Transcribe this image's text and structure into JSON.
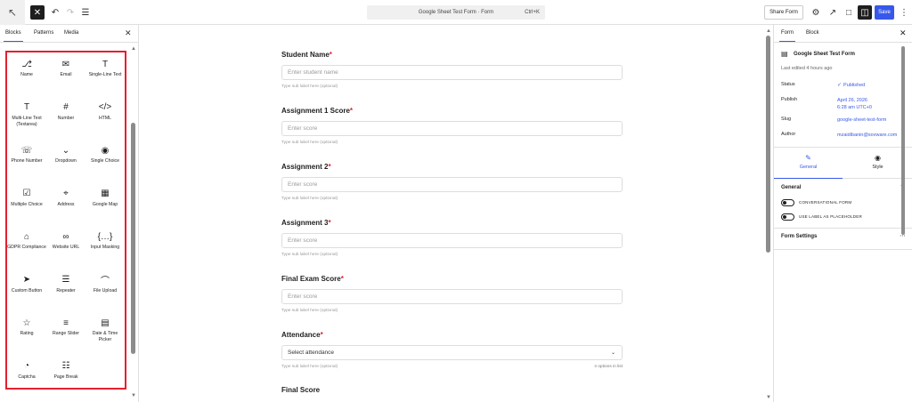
{
  "toolbar": {
    "command_title": "Google Sheet Test Form · Form",
    "command_shortcut": "Ctrl+K",
    "share_label": "Share Form",
    "save_label": "Save"
  },
  "left": {
    "tabs": [
      "Blocks",
      "Patterns",
      "Media"
    ],
    "blocks": [
      {
        "label": "Name",
        "icon": "user-icon",
        "glyph": "⎇"
      },
      {
        "label": "Email",
        "icon": "mail-icon",
        "glyph": "✉"
      },
      {
        "label": "Single-Line Text",
        "icon": "text-icon",
        "glyph": "T"
      },
      {
        "label": "Multi-Line Text (Textarea)",
        "icon": "textarea-icon",
        "glyph": "T"
      },
      {
        "label": "Number",
        "icon": "number-icon",
        "glyph": "#"
      },
      {
        "label": "HTML",
        "icon": "code-icon",
        "glyph": "</>"
      },
      {
        "label": "Phone Number",
        "icon": "phone-icon",
        "glyph": "☏"
      },
      {
        "label": "Dropdown",
        "icon": "dropdown-icon",
        "glyph": "⌄"
      },
      {
        "label": "Single Choice",
        "icon": "radio-icon",
        "glyph": "◉"
      },
      {
        "label": "Multiple Choice",
        "icon": "checkbox-icon",
        "glyph": "☑"
      },
      {
        "label": "Address",
        "icon": "location-icon",
        "glyph": "⌖"
      },
      {
        "label": "Google Map",
        "icon": "map-icon",
        "glyph": "▦"
      },
      {
        "label": "GDPR Compliance",
        "icon": "bank-icon",
        "glyph": "⌂"
      },
      {
        "label": "Website URL",
        "icon": "link-icon",
        "glyph": "∞"
      },
      {
        "label": "Input Masking",
        "icon": "mask-icon",
        "glyph": "{…}"
      },
      {
        "label": "Custom Button",
        "icon": "send-icon",
        "glyph": "➤"
      },
      {
        "label": "Repeater",
        "icon": "repeater-icon",
        "glyph": "☰"
      },
      {
        "label": "File Upload",
        "icon": "paperclip-icon",
        "glyph": "⌒"
      },
      {
        "label": "Rating",
        "icon": "star-icon",
        "glyph": "☆"
      },
      {
        "label": "Range Slider",
        "icon": "slider-icon",
        "glyph": "≡"
      },
      {
        "label": "Date & Time Picker",
        "icon": "calendar-icon",
        "glyph": "▤"
      },
      {
        "label": "Captcha",
        "icon": "captcha-icon",
        "glyph": "◔"
      },
      {
        "label": "Page Break",
        "icon": "page-break-icon",
        "glyph": "☷"
      }
    ]
  },
  "form": {
    "fields": [
      {
        "label": "Student Name",
        "placeholder": "Enter student name",
        "sub": "Type sub label here (optional)"
      },
      {
        "label": "Assignment 1 Score",
        "placeholder": "Enter score",
        "sub": "Type sub label here (optional)"
      },
      {
        "label": "Assignment 2",
        "placeholder": "Enter score",
        "sub": "Type sub label here (optional)"
      },
      {
        "label": "Assignment 3",
        "placeholder": "Enter score",
        "sub": "Type sub label here (optional)"
      },
      {
        "label": "Final Exam Score",
        "placeholder": "Enter score",
        "sub": "Type sub label here (optional)"
      },
      {
        "label": "Attendance",
        "placeholder": "Select attendance",
        "sub": "Type sub label here (optional)",
        "extra": "4 options in list"
      }
    ],
    "final_label": "Final Score"
  },
  "right": {
    "tabs": [
      "Form",
      "Block"
    ],
    "form_title": "Google Sheet Test Form",
    "edited": "Last edited 4 hours ago",
    "meta": [
      {
        "key": "Status",
        "value": "Published"
      },
      {
        "key": "Publish",
        "value": "April 26, 2026",
        "value2": "6:28 am UTC+0"
      },
      {
        "key": "Slug",
        "value": "google-sheet-test-form"
      },
      {
        "key": "Author",
        "value": "mzaidibanin@sovware.com"
      }
    ],
    "style_tabs": [
      "General",
      "Style"
    ],
    "general_title": "General",
    "toggles": [
      "CONVERSATIONAL FORM",
      "USE LABEL AS PLACEHOLDER"
    ],
    "form_settings": "Form Settings"
  },
  "colors": {
    "accent": "#3858e9",
    "highlight": "#e5202f",
    "required": "#e5202f"
  }
}
